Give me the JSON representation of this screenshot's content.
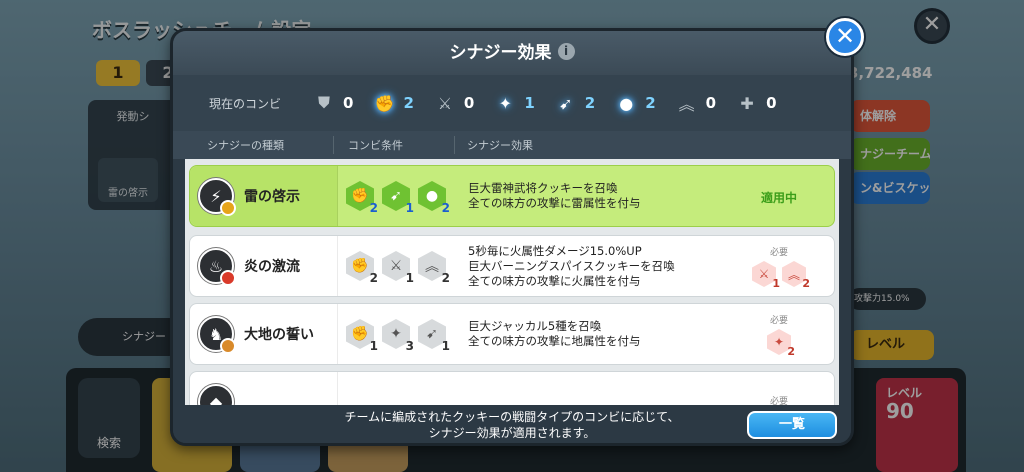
{
  "background": {
    "title": "ボスラッシュチーム設定",
    "tabs": [
      "1",
      "2"
    ],
    "score": "3,722,484",
    "side_buttons": [
      {
        "label": "体解除",
        "color": "#e2573a"
      },
      {
        "label": "ナジーチーム",
        "color": "#6bb32d"
      },
      {
        "label": "ン&ビスケット",
        "color": "#2b7fd9"
      }
    ],
    "left_panel_title": "発動シ",
    "left_panel_chip": "雷の啓示",
    "synergy_pill": "シナジー",
    "search_label": "検索",
    "stat_text": "攻撃力15.0%",
    "level_button": "レベル",
    "level_card_label": "レベル",
    "level_card_value": "90"
  },
  "modal": {
    "title": "シナジー効果",
    "combo_label": "現在のコンビ",
    "combo": [
      {
        "icon": "shield-icon",
        "glyph": "⛊",
        "count": "0",
        "active": false
      },
      {
        "icon": "fist-icon",
        "glyph": "✊",
        "count": "2",
        "active": true
      },
      {
        "icon": "dagger-icon",
        "glyph": "⚔",
        "count": "0",
        "active": false
      },
      {
        "icon": "magic-icon",
        "glyph": "✦",
        "count": "1",
        "active": true
      },
      {
        "icon": "arrow-icon",
        "glyph": "➹",
        "count": "2",
        "active": true
      },
      {
        "icon": "bomb-icon",
        "glyph": "●",
        "count": "2",
        "active": true
      },
      {
        "icon": "chevron-up-icon",
        "glyph": "︽",
        "count": "0",
        "active": false
      },
      {
        "icon": "plus-icon",
        "glyph": "✚",
        "count": "0",
        "active": false
      }
    ],
    "headers": {
      "type": "シナジーの種類",
      "cond": "コンビ条件",
      "effect": "シナジー効果"
    },
    "rows": [
      {
        "name": "雷の啓示",
        "emblem_icon": "lightning-icon",
        "emblem_glyph": "⚡",
        "badge_color": "#e6a41a",
        "conditions": [
          {
            "icon": "fist-icon",
            "glyph": "✊",
            "num": "2",
            "on": true
          },
          {
            "icon": "arrow-icon",
            "glyph": "➹",
            "num": "1",
            "on": true
          },
          {
            "icon": "bomb-icon",
            "glyph": "●",
            "num": "2",
            "on": true
          }
        ],
        "effect_lines": [
          "巨大雷神武将クッキーを召喚",
          "全ての味方の攻撃に雷属性を付与"
        ],
        "status": "適用中",
        "need_label": "",
        "needs": []
      },
      {
        "name": "炎の激流",
        "emblem_icon": "fire-icon",
        "emblem_glyph": "♨",
        "badge_color": "#d93a2a",
        "conditions": [
          {
            "icon": "fist-icon",
            "glyph": "✊",
            "num": "2",
            "on": false
          },
          {
            "icon": "dagger-icon",
            "glyph": "⚔",
            "num": "1",
            "on": false
          },
          {
            "icon": "chevron-up-icon",
            "glyph": "︽",
            "num": "2",
            "on": false
          }
        ],
        "effect_lines": [
          "5秒毎に火属性ダメージ15.0%UP",
          "巨大バーニングスパイスクッキーを召喚",
          "全ての味方の攻撃に火属性を付与"
        ],
        "status": "",
        "need_label": "必要",
        "needs": [
          {
            "icon": "dagger-icon",
            "glyph": "⚔",
            "num": "1"
          },
          {
            "icon": "chevron-up-icon",
            "glyph": "︽",
            "num": "2"
          }
        ]
      },
      {
        "name": "大地の誓い",
        "emblem_icon": "jackal-icon",
        "emblem_glyph": "♞",
        "badge_color": "#d98a2a",
        "conditions": [
          {
            "icon": "fist-icon",
            "glyph": "✊",
            "num": "1",
            "on": false
          },
          {
            "icon": "magic-icon",
            "glyph": "✦",
            "num": "3",
            "on": false
          },
          {
            "icon": "arrow-icon",
            "glyph": "➹",
            "num": "1",
            "on": false
          }
        ],
        "effect_lines": [
          "巨大ジャッカル5種を召喚",
          "全ての味方の攻撃に地属性を付与"
        ],
        "status": "",
        "need_label": "必要",
        "needs": [
          {
            "icon": "magic-icon",
            "glyph": "✦",
            "num": "2"
          }
        ]
      }
    ],
    "partial_row": {
      "name": "",
      "need_label": "必要"
    },
    "footer_lines": [
      "チームに編成されたクッキーの戦闘タイプのコンビに応じて、",
      "シナジー効果が適用されます。"
    ],
    "list_button": "一覧"
  }
}
